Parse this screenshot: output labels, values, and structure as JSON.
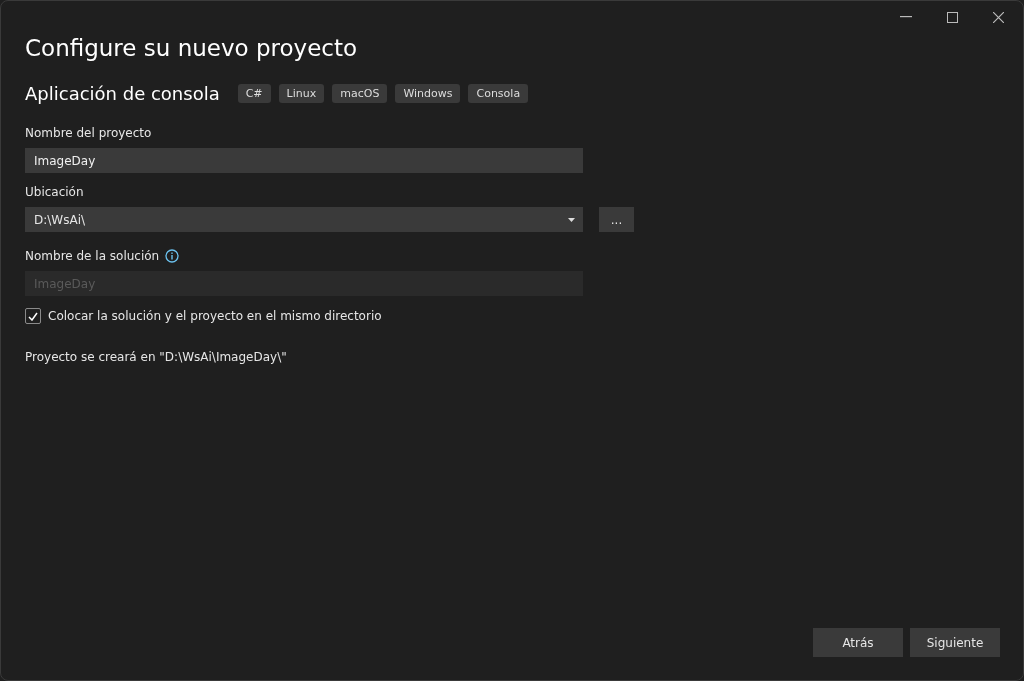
{
  "window": {
    "title": "Configure su nuevo proyecto"
  },
  "template": {
    "name": "Aplicación de consola",
    "tags": [
      "C#",
      "Linux",
      "macOS",
      "Windows",
      "Consola"
    ]
  },
  "project_name": {
    "label": "Nombre del proyecto",
    "value": "ImageDay"
  },
  "location": {
    "label": "Ubicación",
    "value": "D:\\WsAi\\",
    "browse": "..."
  },
  "solution_name": {
    "label": "Nombre de la solución",
    "value": "ImageDay",
    "disabled": true
  },
  "same_directory": {
    "label": "Colocar la solución y el proyecto en el mismo directorio",
    "checked": true
  },
  "summary": "Proyecto se creará en \"D:\\WsAi\\ImageDay\\\"",
  "buttons": [
    "Atrás",
    "Siguiente"
  ]
}
